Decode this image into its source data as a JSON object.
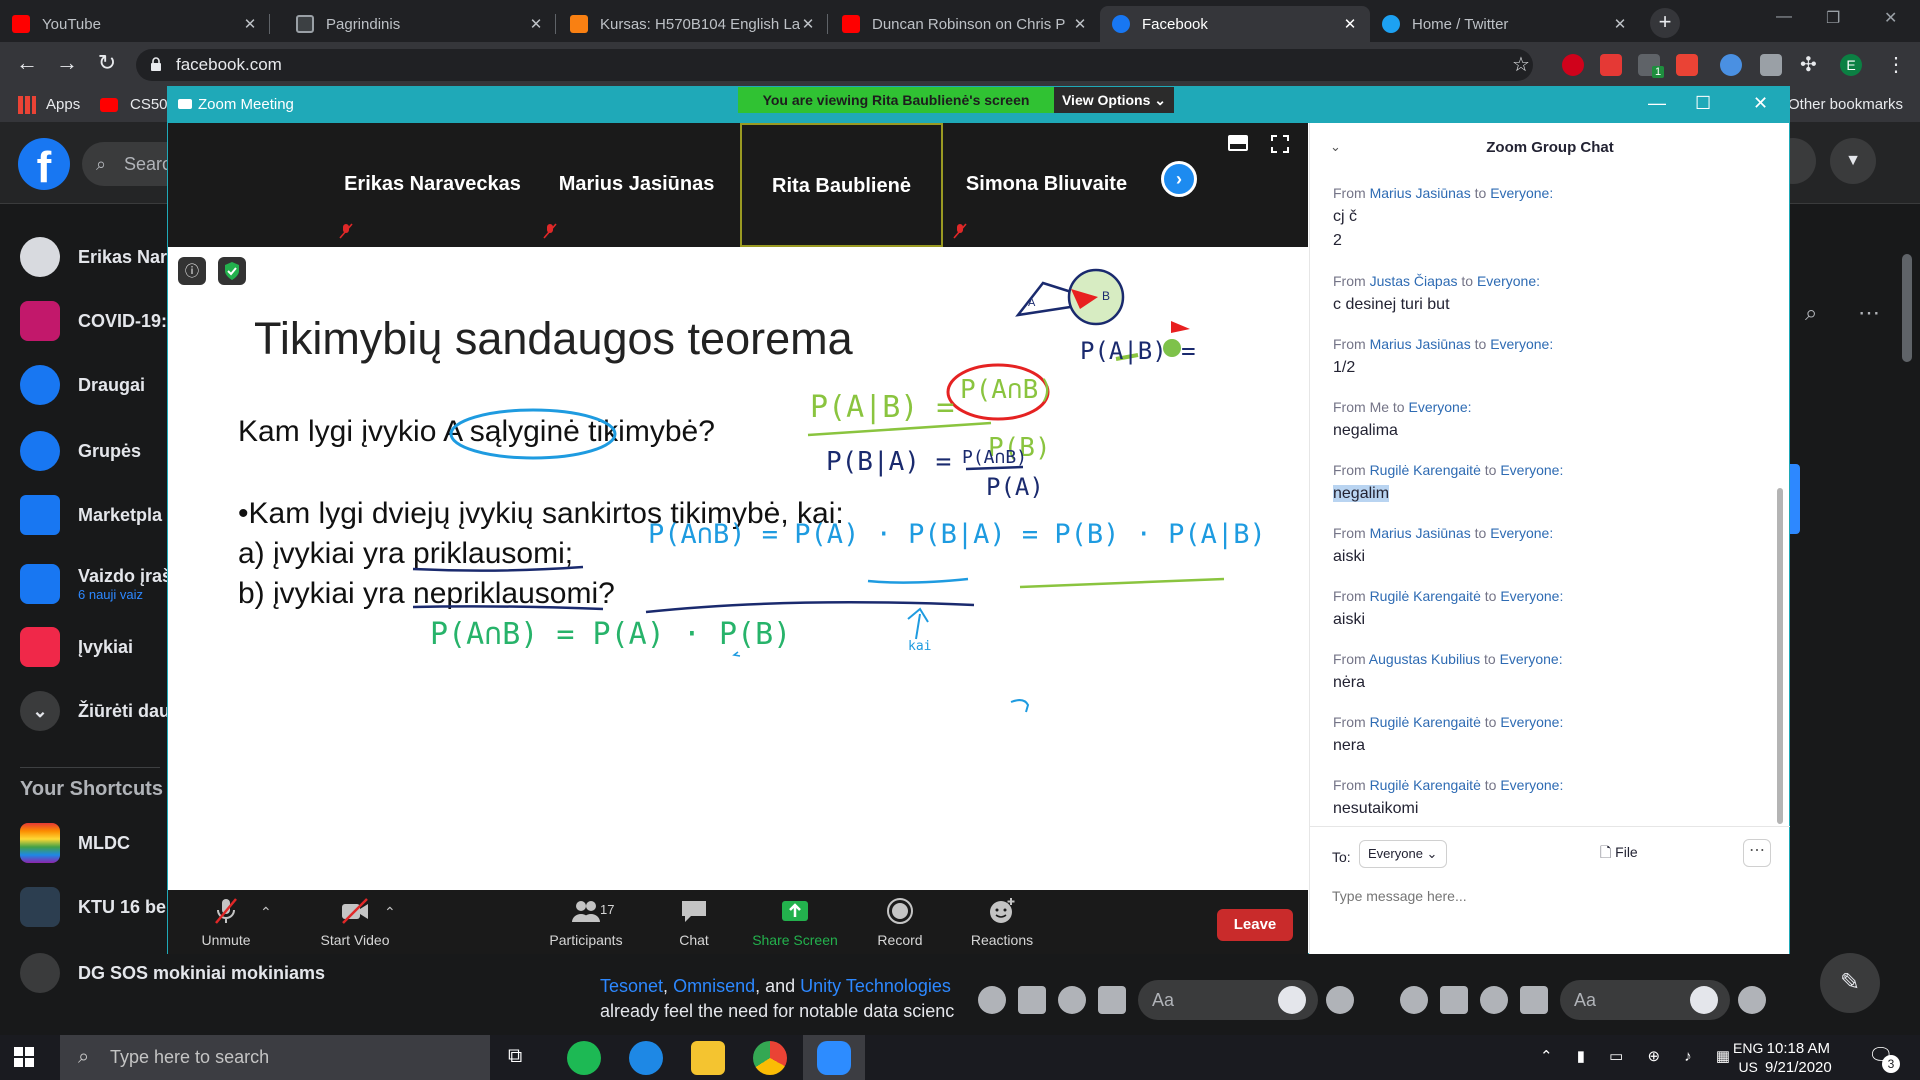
{
  "browser": {
    "tabs": [
      {
        "title": "YouTube",
        "favicon_color": "#ff0000"
      },
      {
        "title": "Pagrindinis",
        "favicon_color": "#5f6368"
      },
      {
        "title": "Kursas: H570B104 English La",
        "favicon_color": "#f98012"
      },
      {
        "title": "Duncan Robinson on Chris P",
        "favicon_color": "#ff0000"
      },
      {
        "title": "Facebook",
        "favicon_color": "#1877f2",
        "active": true
      },
      {
        "title": "Home / Twitter",
        "favicon_color": "#1da1f2"
      }
    ],
    "url": "facebook.com",
    "bookmarks": {
      "apps": "Apps",
      "cs50": "CS50",
      "other": "Other bookmarks"
    },
    "profile_letter": "E",
    "ext_badge": "1"
  },
  "facebook": {
    "search_placeholder": "Searc",
    "nav": [
      {
        "label": "Erikas Nar",
        "icon": "avatar"
      },
      {
        "label": "COVID-19:",
        "icon": "covid-heart-icon"
      },
      {
        "label": "Draugai",
        "icon": "friends-icon"
      },
      {
        "label": "Grupės",
        "icon": "groups-icon"
      },
      {
        "label": "Marketpla",
        "icon": "marketplace-icon"
      },
      {
        "label": "Vaizdo įraš",
        "icon": "video-icon",
        "sub": "6 nauji vaiz"
      },
      {
        "label": "Įvykiai",
        "icon": "events-icon"
      },
      {
        "label": "Žiūrėti dau",
        "icon": "chevron-down-icon"
      }
    ],
    "shortcuts_title": "Your Shortcuts",
    "shortcuts": [
      "MLDC",
      "KTU 16 be",
      "DG SOS mokiniai mokiniams"
    ],
    "post_text_links": [
      "Tesonet",
      "Omnisend",
      "Unity Technologies"
    ],
    "post_text_sep1": ", ",
    "post_text_sep2": ", and ",
    "post_text_line2": "already feel the need for notable data scienc",
    "msg_placeholder": "Aa"
  },
  "zoom": {
    "window_title": "Zoom Meeting",
    "viewing_banner": "You are viewing Rita Baublienė's screen",
    "view_options": "View Options",
    "participants": [
      {
        "name": "Erikas Naraveckas",
        "muted": true
      },
      {
        "name": "Marius Jasiūnas",
        "muted": true
      },
      {
        "name": "Rita Baublienė",
        "muted": false,
        "active": true
      },
      {
        "name": "Simona Bliuvaite",
        "muted": true
      }
    ],
    "slide": {
      "title": "Tikimybių sandaugos teorema",
      "q1_prefix": "Kam lygi įvykio ",
      "q1_circled": "A sąlyginė",
      "q1_suffix": " tikimybė?",
      "q2": "•Kam lygi dviejų įvykių sankirtos tikimybė, kai:",
      "a_prefix": "a) įvykiai yra ",
      "a_word": "priklausomi;",
      "b_prefix": "b) įvykiai yra ",
      "b_word": "nepriklausomi?"
    },
    "annotations": {
      "green1_lhs": "P(A|B) =",
      "red_num": "P(A∩B)",
      "green1_den": "P(B)",
      "navy_lhs": "P(B|A) =",
      "navy_num": "P(A∩B)",
      "navy_den": "P(A)",
      "teal_eq": "P(A∩B) = P(A) · P(B|A) = P(B) · P(A|B)",
      "green_eq": "P(A∩B) = P(A) · P(B)",
      "navy_kai": "kai",
      "right_formula": "P(A|B) =",
      "venn_a": "A",
      "venn_b": "B"
    },
    "toolbar": {
      "unmute": "Unmute",
      "start_video": "Start Video",
      "participants": "Participants",
      "participants_count": "17",
      "chat": "Chat",
      "share": "Share Screen",
      "record": "Record",
      "reactions": "Reactions",
      "leave": "Leave"
    },
    "chat": {
      "title": "Zoom Group Chat",
      "messages": [
        {
          "from": "Marius Jasiūnas",
          "to": "Everyone",
          "lines": [
            "cj č",
            "2"
          ]
        },
        {
          "from": "Justas Čiapas",
          "to": "Everyone",
          "lines": [
            "c desinej turi but"
          ]
        },
        {
          "from": "Marius Jasiūnas",
          "to": "Everyone",
          "lines": [
            "1/2"
          ]
        },
        {
          "from": "Me",
          "to": "Everyone",
          "lines": [
            "negalima"
          ]
        },
        {
          "from": "Rugilė Karengaitė",
          "to": "Everyone",
          "lines": [
            "negalim"
          ],
          "highlight": true
        },
        {
          "from": "Marius Jasiūnas",
          "to": "Everyone",
          "lines": [
            "aiski"
          ]
        },
        {
          "from": "Rugilė Karengaitė",
          "to": "Everyone",
          "lines": [
            "aiski"
          ]
        },
        {
          "from": "Augustas Kubilius",
          "to": "Everyone",
          "lines": [
            "nėra"
          ]
        },
        {
          "from": "Rugilė Karengaitė",
          "to": "Everyone",
          "lines": [
            "nera"
          ]
        },
        {
          "from": "Rugilė Karengaitė",
          "to": "Everyone",
          "lines": [
            "nesutaikomi"
          ]
        }
      ],
      "from_word": "From",
      "to_word": "to",
      "to_label": "To:",
      "to_value": "Everyone",
      "file_label": "File",
      "input_placeholder": "Type message here..."
    }
  },
  "taskbar": {
    "search_placeholder": "Type here to search",
    "lang1": "ENG",
    "lang2": "US",
    "time": "10:18 AM",
    "date": "9/21/2020",
    "notif_count": "3"
  }
}
